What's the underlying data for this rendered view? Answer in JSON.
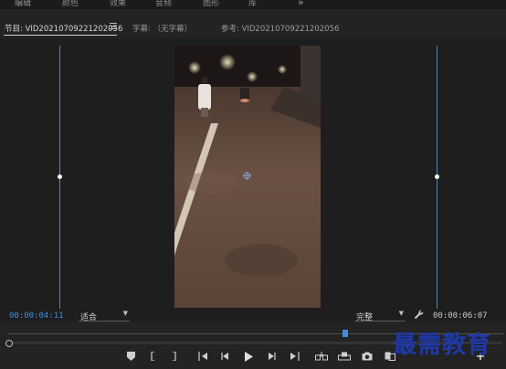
{
  "top_tabs": [
    "编辑",
    "颜色",
    "效果",
    "音频",
    "图形",
    "库"
  ],
  "top_more": "»",
  "panel_tabs": {
    "program": "节目: VID20210709221202056",
    "captions": "字幕: （无字幕）",
    "reference": "参考: VID20210709221202056"
  },
  "monitor": {
    "current_timecode": "00:00:04:11",
    "zoom_select": "适合",
    "quality_select": "完整",
    "duration_timecode": "00:00:06:07",
    "playhead_fraction": 0.68
  },
  "transport_icons": [
    "marker-icon",
    "mark-in-icon",
    "mark-out-icon",
    "go-to-in-icon",
    "step-back-icon",
    "play-icon",
    "step-forward-icon",
    "go-to-out-icon",
    "insert-icon",
    "overwrite-icon",
    "export-frame-icon",
    "compare-icon",
    "add-button-icon"
  ],
  "watermark": "最需教育",
  "colors": {
    "accent": "#3b8fe0",
    "watermark": "#1f38a8"
  }
}
